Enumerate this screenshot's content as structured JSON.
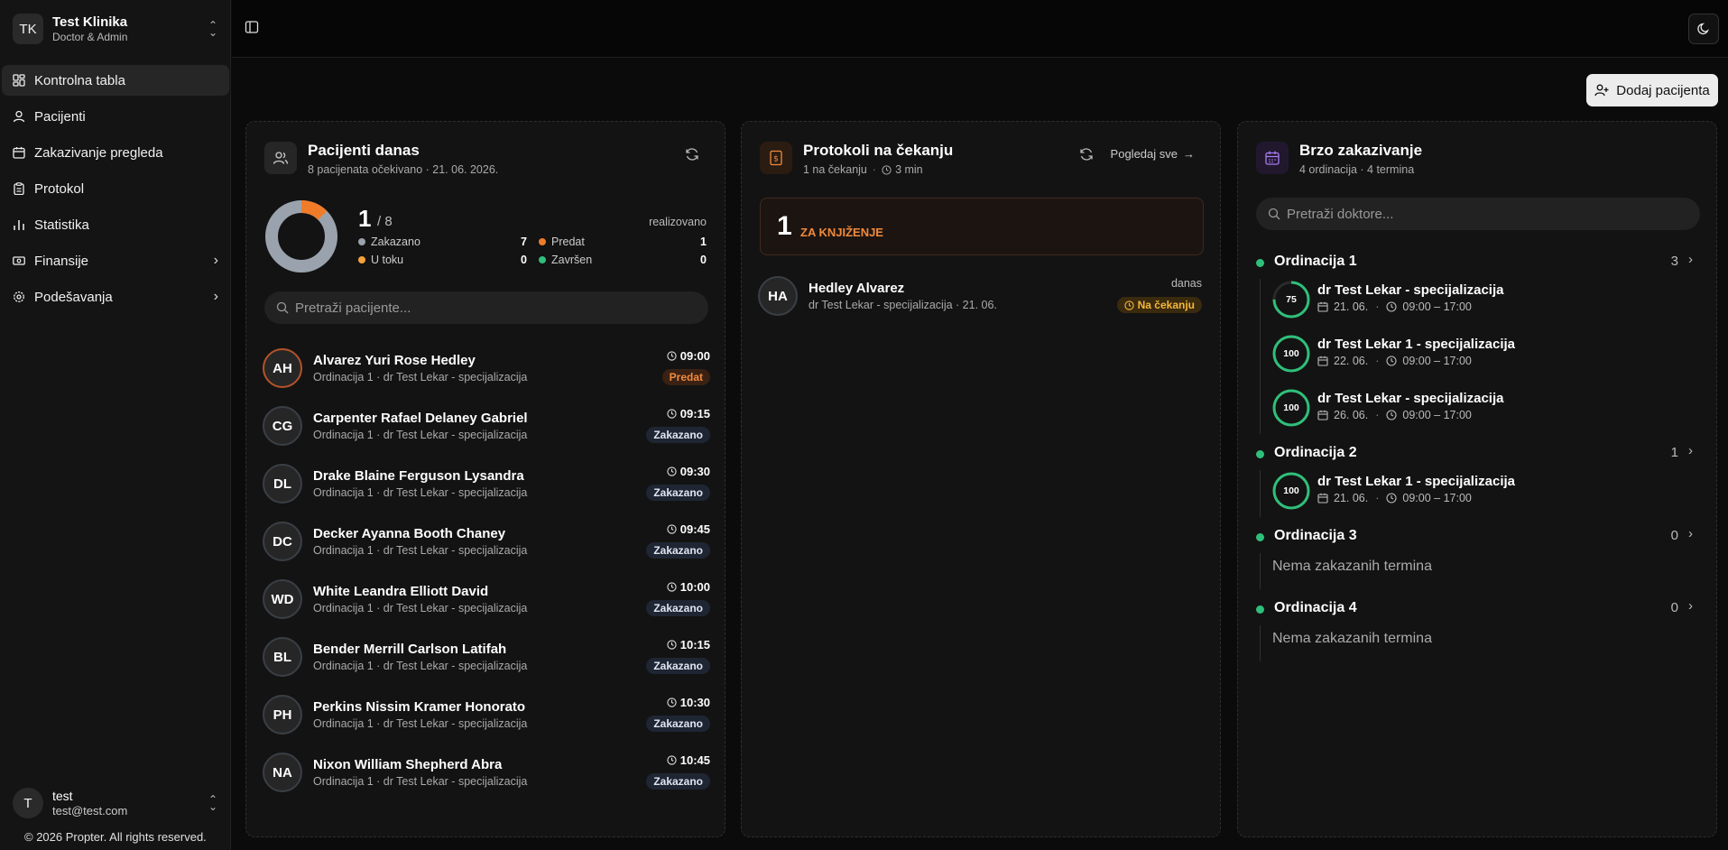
{
  "org": {
    "initials": "TK",
    "name": "Test Klinika",
    "role": "Doctor & Admin"
  },
  "nav": [
    {
      "label": "Kontrolna tabla",
      "icon": "dashboard-icon",
      "active": true
    },
    {
      "label": "Pacijenti",
      "icon": "user-icon"
    },
    {
      "label": "Zakazivanje pregleda",
      "icon": "calendar-icon"
    },
    {
      "label": "Protokol",
      "icon": "clipboard-icon"
    },
    {
      "label": "Statistika",
      "icon": "bar-chart-icon"
    },
    {
      "label": "Finansije",
      "icon": "banknote-icon",
      "chevron": true
    },
    {
      "label": "Podešavanja",
      "icon": "gear-icon",
      "chevron": true
    }
  ],
  "user": {
    "initial": "T",
    "name": "test",
    "email": "test@test.com"
  },
  "footer": {
    "copyright": "© 2026 Propter. All rights reserved."
  },
  "header": {
    "add_patient": "Dodaj pacijenta"
  },
  "patients_today": {
    "title": "Pacijenti danas",
    "subtitle": "8 pacijenata očekivano · 21. 06. 2026.",
    "done": "1",
    "total": "/ 8",
    "done_label": "realizovano",
    "done_fraction": 0.125,
    "legend": [
      {
        "label": "Zakazano",
        "value": "7",
        "color": "#9aa3ad"
      },
      {
        "label": "Predat",
        "value": "1",
        "color": "#f07c2a"
      },
      {
        "label": "U toku",
        "value": "0",
        "color": "#f5a23a"
      },
      {
        "label": "Završen",
        "value": "0",
        "color": "#2fbf7a"
      }
    ],
    "search_placeholder": "Pretraži pacijente...",
    "patients": [
      {
        "initials": "AH",
        "name": "Alvarez Yuri Rose Hedley",
        "detail": "Ordinacija 1 · dr Test Lekar - specijalizacija",
        "time": "09:00",
        "status": "Predat",
        "status_type": "orange"
      },
      {
        "initials": "CG",
        "name": "Carpenter Rafael Delaney Gabriel",
        "detail": "Ordinacija 1 · dr Test Lekar - specijalizacija",
        "time": "09:15",
        "status": "Zakazano",
        "status_type": "blue"
      },
      {
        "initials": "DL",
        "name": "Drake Blaine Ferguson Lysandra",
        "detail": "Ordinacija 1 · dr Test Lekar - specijalizacija",
        "time": "09:30",
        "status": "Zakazano",
        "status_type": "blue"
      },
      {
        "initials": "DC",
        "name": "Decker Ayanna Booth Chaney",
        "detail": "Ordinacija 1 · dr Test Lekar - specijalizacija",
        "time": "09:45",
        "status": "Zakazano",
        "status_type": "blue"
      },
      {
        "initials": "WD",
        "name": "White Leandra Elliott David",
        "detail": "Ordinacija 1 · dr Test Lekar - specijalizacija",
        "time": "10:00",
        "status": "Zakazano",
        "status_type": "blue"
      },
      {
        "initials": "BL",
        "name": "Bender Merrill Carlson Latifah",
        "detail": "Ordinacija 1 · dr Test Lekar - specijalizacija",
        "time": "10:15",
        "status": "Zakazano",
        "status_type": "blue"
      },
      {
        "initials": "PH",
        "name": "Perkins Nissim Kramer Honorato",
        "detail": "Ordinacija 1 · dr Test Lekar - specijalizacija",
        "time": "10:30",
        "status": "Zakazano",
        "status_type": "blue"
      },
      {
        "initials": "NA",
        "name": "Nixon William Shepherd Abra",
        "detail": "Ordinacija 1 · dr Test Lekar - specijalizacija",
        "time": "10:45",
        "status": "Zakazano",
        "status_type": "blue"
      }
    ]
  },
  "protocols": {
    "title": "Protokoli na čekanju",
    "subtitle_count": "1 na čekanju",
    "subtitle_time": "3 min",
    "view_all": "Pogledaj sve",
    "pending_count": "1",
    "pending_label": "ZA KNJIŽENJE",
    "items": [
      {
        "initials": "HA",
        "name": "Hedley Alvarez",
        "detail": "dr Test Lekar - specijalizacija · 21. 06.",
        "when": "danas",
        "status": "Na čekanju"
      }
    ]
  },
  "quick": {
    "title": "Brzo zakazivanje",
    "subtitle": "4 ordinacija · 4 termina",
    "search_placeholder": "Pretraži doktore...",
    "empty_text": "Nema zakazanih termina",
    "groups": [
      {
        "name": "Ordinacija 1",
        "count": "3",
        "doctors": [
          {
            "name": "dr Test Lekar - specijalizacija",
            "date": "21. 06.",
            "hours": "09:00 – 17:00",
            "pct": "75"
          },
          {
            "name": "dr Test Lekar 1 - specijalizacija",
            "date": "22. 06.",
            "hours": "09:00 – 17:00",
            "pct": "100"
          },
          {
            "name": "dr Test Lekar - specijalizacija",
            "date": "26. 06.",
            "hours": "09:00 – 17:00",
            "pct": "100"
          }
        ]
      },
      {
        "name": "Ordinacija 2",
        "count": "1",
        "doctors": [
          {
            "name": "dr Test Lekar 1 - specijalizacija",
            "date": "21. 06.",
            "hours": "09:00 – 17:00",
            "pct": "100"
          }
        ]
      },
      {
        "name": "Ordinacija 3",
        "count": "0",
        "doctors": []
      },
      {
        "name": "Ordinacija 4",
        "count": "0",
        "doctors": []
      }
    ]
  },
  "colors": {
    "accent_green": "#2fbf7a",
    "accent_orange": "#f07c2a",
    "gray": "#9aa3ad"
  }
}
